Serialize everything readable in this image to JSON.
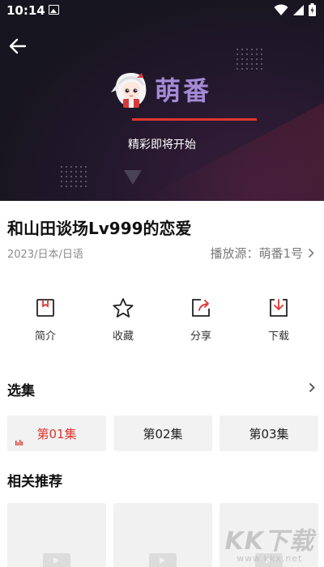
{
  "status_bar": {
    "time": "10:14"
  },
  "player": {
    "brand_name": "萌番",
    "caption": "精彩即将开始",
    "progress": 1.0
  },
  "anime": {
    "title": "和山田谈场Lv999的恋爱",
    "meta": "2023/日本/日语",
    "source_label": "播放源：萌番1号"
  },
  "actions": [
    {
      "label": "简介",
      "icon": "bookmark-icon"
    },
    {
      "label": "收藏",
      "icon": "star-icon"
    },
    {
      "label": "分享",
      "icon": "share-icon"
    },
    {
      "label": "下载",
      "icon": "download-icon"
    }
  ],
  "episodes_section": {
    "title": "选集",
    "episodes": [
      {
        "label": "第01集",
        "active": true
      },
      {
        "label": "第02集",
        "active": false
      },
      {
        "label": "第03集",
        "active": false
      }
    ]
  },
  "recommend_section": {
    "title": "相关推荐"
  },
  "watermark": {
    "main": "KK下载",
    "sub": "www.kkx.net"
  },
  "colors": {
    "accent": "#e0352f",
    "brand": "#a58ad6"
  }
}
